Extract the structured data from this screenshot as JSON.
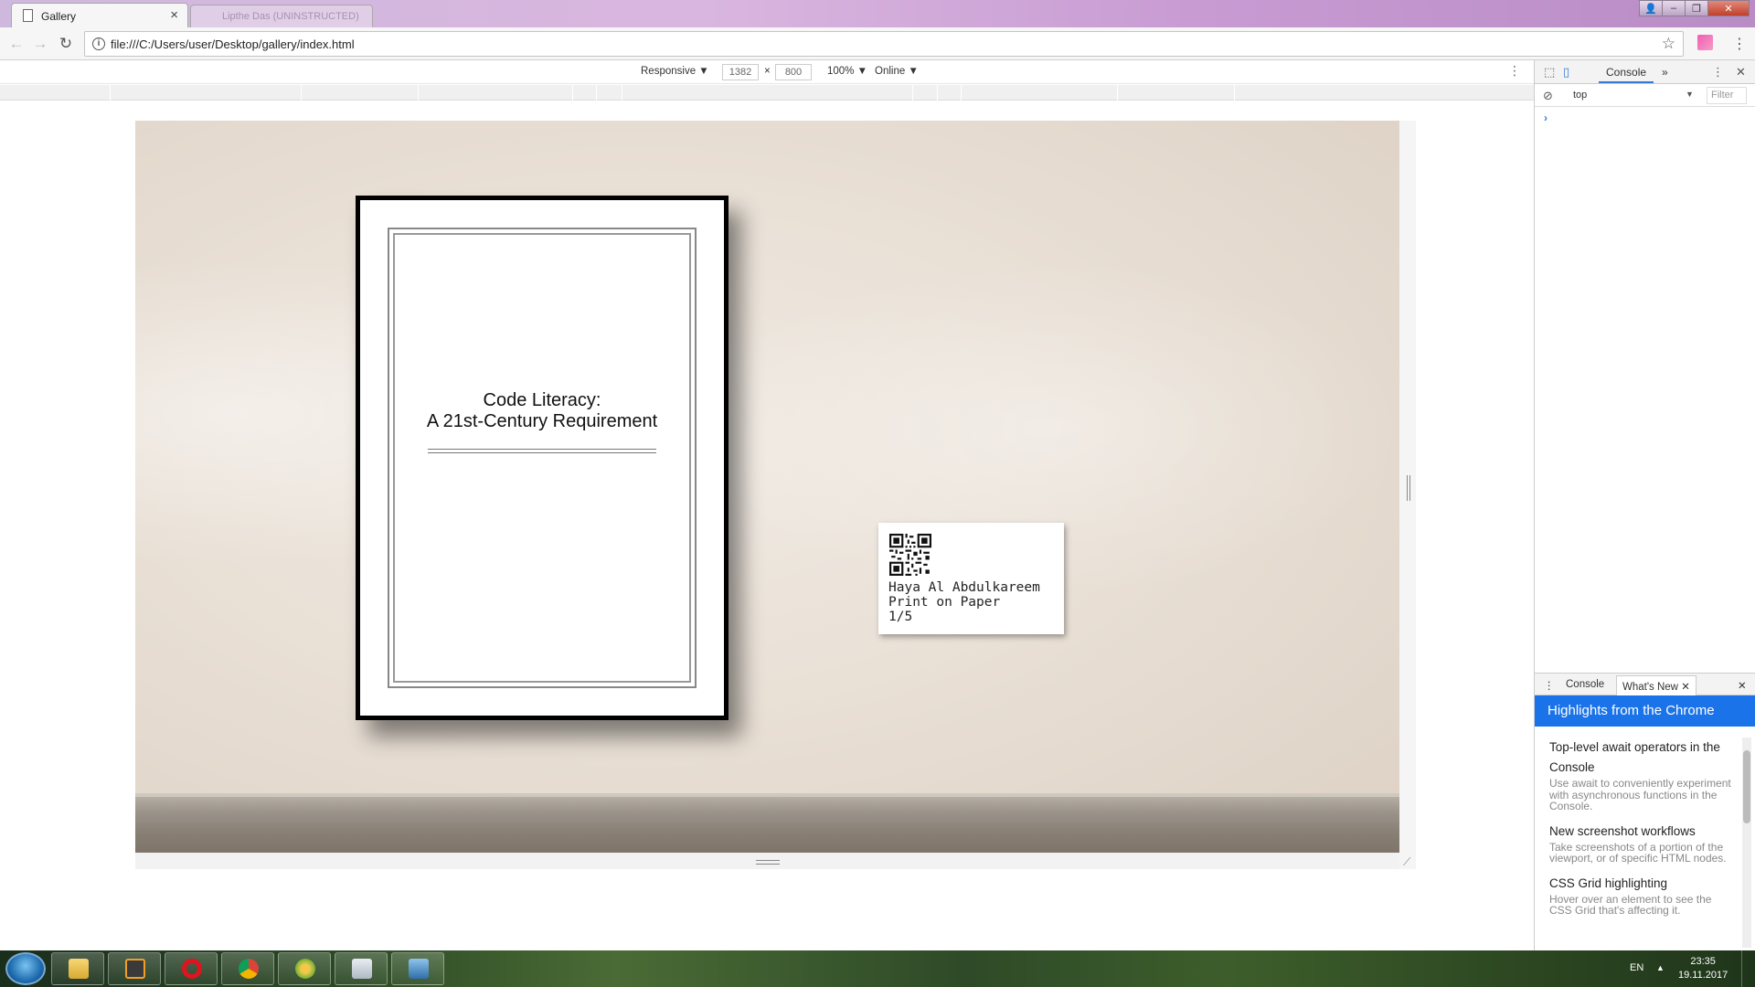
{
  "browser": {
    "active_tab_title": "Gallery",
    "inactive_tab_title": "Lipthe Das (UNINSTRUCTED)",
    "url": "file:///C:/Users/user/Desktop/gallery/index.html",
    "close_glyph": "×"
  },
  "device_toolbar": {
    "mode": "Responsive",
    "width": "1382",
    "times": "×",
    "height": "800",
    "zoom": "100%",
    "network": "Online"
  },
  "artwork": {
    "title_line1": "Code Literacy:",
    "title_line2": "A 21st-Century Requirement"
  },
  "label": {
    "artist": "Haya Al Abdulkareem",
    "medium": "Print on Paper",
    "edition": "1/5"
  },
  "devtools": {
    "tab_console": "Console",
    "more_tabs": "»",
    "context": "top",
    "filter_placeholder": "Filter",
    "prompt": "›",
    "drawer_tab_console": "Console",
    "drawer_tab_whats_new": "What's New",
    "banner": "Highlights from the Chrome",
    "whats_new": [
      {
        "title": "Top-level await operators in the Console",
        "desc": "Use await to conveniently experiment with asynchronous functions in the Console."
      },
      {
        "title": "New screenshot workflows",
        "desc": "Take screenshots of a portion of the viewport, or of specific HTML nodes."
      },
      {
        "title": "CSS Grid highlighting",
        "desc": "Hover over an element to see the CSS Grid that's affecting it."
      }
    ]
  },
  "taskbar": {
    "language": "EN",
    "time": "23:35",
    "date": "19.11.2017"
  },
  "colors": {
    "accent_blue": "#1a73e8",
    "wall": "#e9e0d6",
    "frame": "#000000"
  }
}
